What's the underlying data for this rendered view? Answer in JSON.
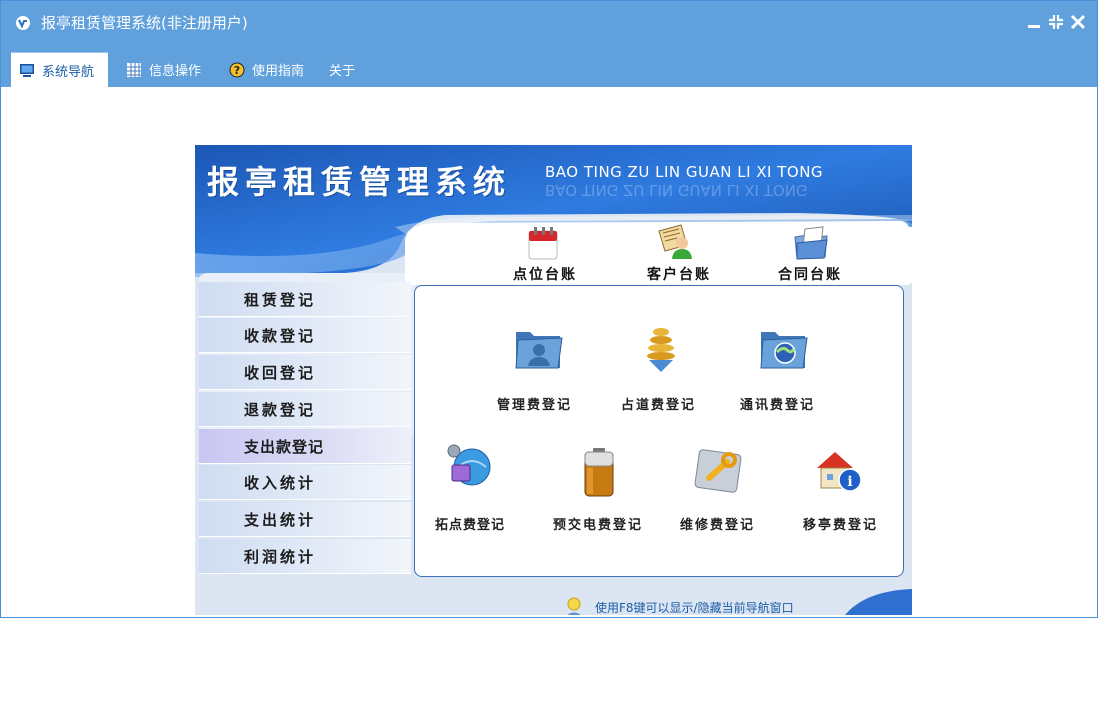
{
  "window": {
    "title": "报亭租赁管理系统(非注册用户)"
  },
  "menu": {
    "tabs": [
      {
        "label": "系统导航",
        "icon": "monitor-icon",
        "active": true
      },
      {
        "label": "信息操作",
        "icon": "grid-icon",
        "active": false
      },
      {
        "label": "使用指南",
        "icon": "help-icon",
        "active": false
      },
      {
        "label": "关于",
        "icon": "",
        "active": false
      }
    ]
  },
  "banner": {
    "title": "报亭租赁管理系统",
    "pinyin": "BAO TING ZU LIN GUAN LI XI TONG"
  },
  "top_items": [
    {
      "label": "点位台账",
      "icon": "calendar-icon"
    },
    {
      "label": "客户台账",
      "icon": "customer-icon"
    },
    {
      "label": "合同台账",
      "icon": "document-folder-icon"
    }
  ],
  "nav": [
    {
      "label": "租赁登记"
    },
    {
      "label": "收款登记"
    },
    {
      "label": "收回登记"
    },
    {
      "label": "退款登记"
    },
    {
      "label": "支出款登记",
      "highlighted": true
    },
    {
      "label": "收入统计"
    },
    {
      "label": "支出统计"
    },
    {
      "label": "利润统计"
    }
  ],
  "grid_items": [
    {
      "label": "管理费登记",
      "icon": "user-folder-icon"
    },
    {
      "label": "占道费登记",
      "icon": "spring-icon"
    },
    {
      "label": "通讯费登记",
      "icon": "globe-folder-icon"
    },
    {
      "label": "拓点费登记",
      "icon": "network-icon"
    },
    {
      "label": "预交电费登记",
      "icon": "battery-icon"
    },
    {
      "label": "维修费登记",
      "icon": "wrench-icon"
    },
    {
      "label": "移亭费登记",
      "icon": "house-info-icon"
    }
  ],
  "tip": "使用F8键可以显示/隐藏当前导航窗口",
  "colors": {
    "titlebar": "#5fa0dd",
    "accent": "#1b5ea8",
    "border": "#3d6fb8"
  }
}
